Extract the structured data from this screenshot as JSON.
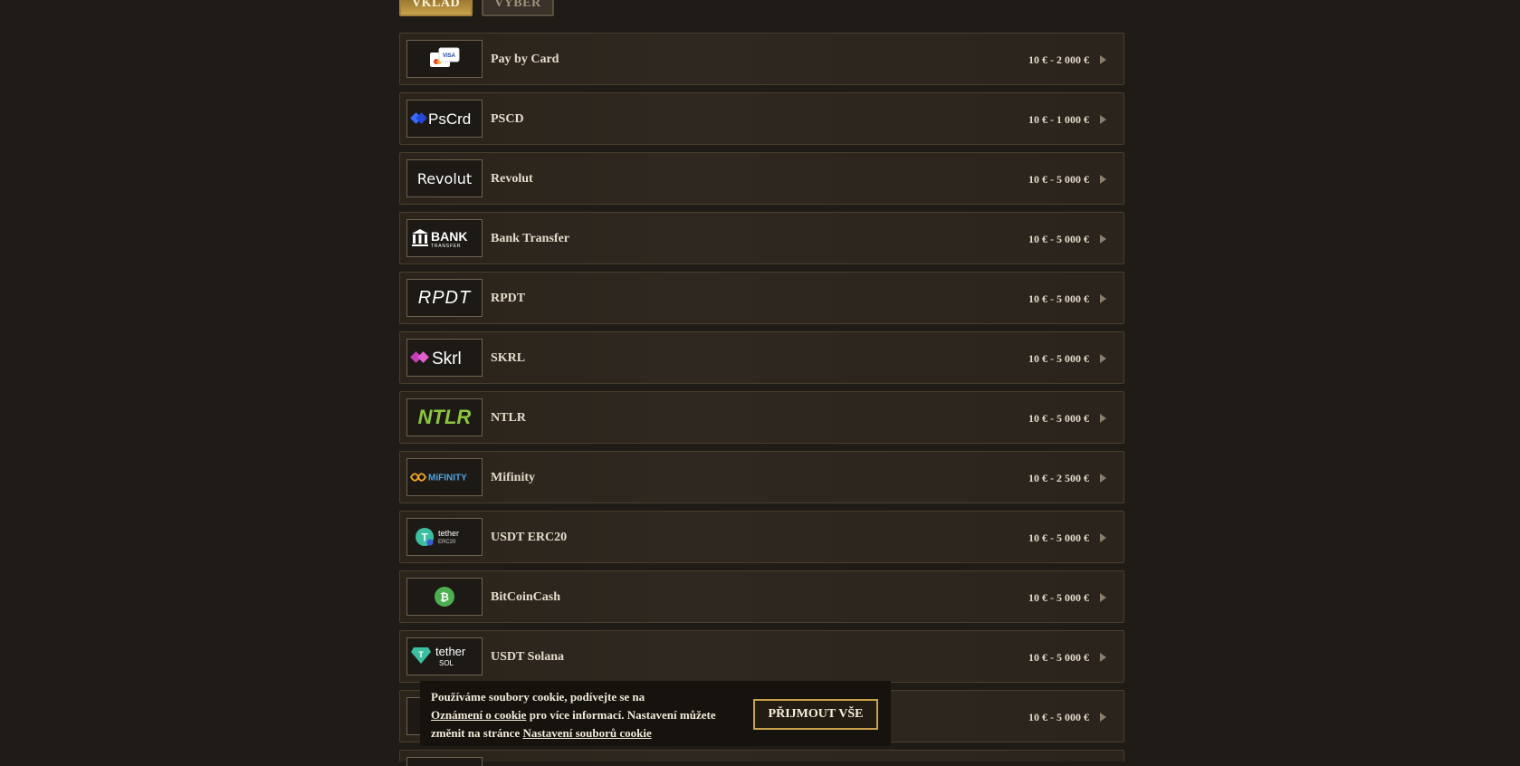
{
  "tabs": {
    "deposit": "VKLAD",
    "withdraw": "VÝBĚR"
  },
  "methods": [
    {
      "name": "Pay by Card",
      "range": "10 € - 2 000 €",
      "icon": "card-logo-icon"
    },
    {
      "name": "PSCD",
      "range": "10 € - 1 000 €",
      "icon": "pscrd-logo-icon",
      "logo": "PsCrd"
    },
    {
      "name": "Revolut",
      "range": "10 € - 5 000 €",
      "icon": "revolut-logo-icon",
      "logo": "Revolut"
    },
    {
      "name": "Bank Transfer",
      "range": "10 € - 5 000 €",
      "icon": "bank-logo-icon",
      "logo": "BANK",
      "logo_sub": "TRANSFER"
    },
    {
      "name": "RPDT",
      "range": "10 € - 5 000 €",
      "icon": "rpdt-logo-icon",
      "logo": "RPDT"
    },
    {
      "name": "SKRL",
      "range": "10 € - 5 000 €",
      "icon": "skrl-logo-icon",
      "logo": "Skrl"
    },
    {
      "name": "NTLR",
      "range": "10 € - 5 000 €",
      "icon": "ntlr-logo-icon",
      "logo": "NTLR"
    },
    {
      "name": "Mifinity",
      "range": "10 € - 2 500 €",
      "icon": "mifinity-logo-icon",
      "logo": "MiFINITY"
    },
    {
      "name": "USDT ERC20",
      "range": "10 € - 5 000 €",
      "icon": "tether-erc20-logo-icon",
      "logo": "tether",
      "logo_sub": "ERC20"
    },
    {
      "name": "BitCoinCash",
      "range": "10 € - 5 000 €",
      "icon": "bitcoincash-logo-icon"
    },
    {
      "name": "USDT Solana",
      "range": "10 € - 5 000 €",
      "icon": "tether-sol-logo-icon",
      "logo": "tether",
      "logo_sub": "SOL"
    },
    {
      "name": "",
      "range": "10 € - 5 000 €",
      "icon": "payment-logo-icon"
    }
  ],
  "cookie": {
    "line1": "Používáme soubory cookie, podívejte se na",
    "link1": "Oznámení o cookie",
    "mid": " pro více informací. Nastavení můžete změnit na stránce ",
    "link2": "Nastavení souborů cookie",
    "accept_label": "PŘIJMOUT VŠE"
  },
  "colors": {
    "accent": "#c9a24c",
    "background": "#1f1b16"
  }
}
